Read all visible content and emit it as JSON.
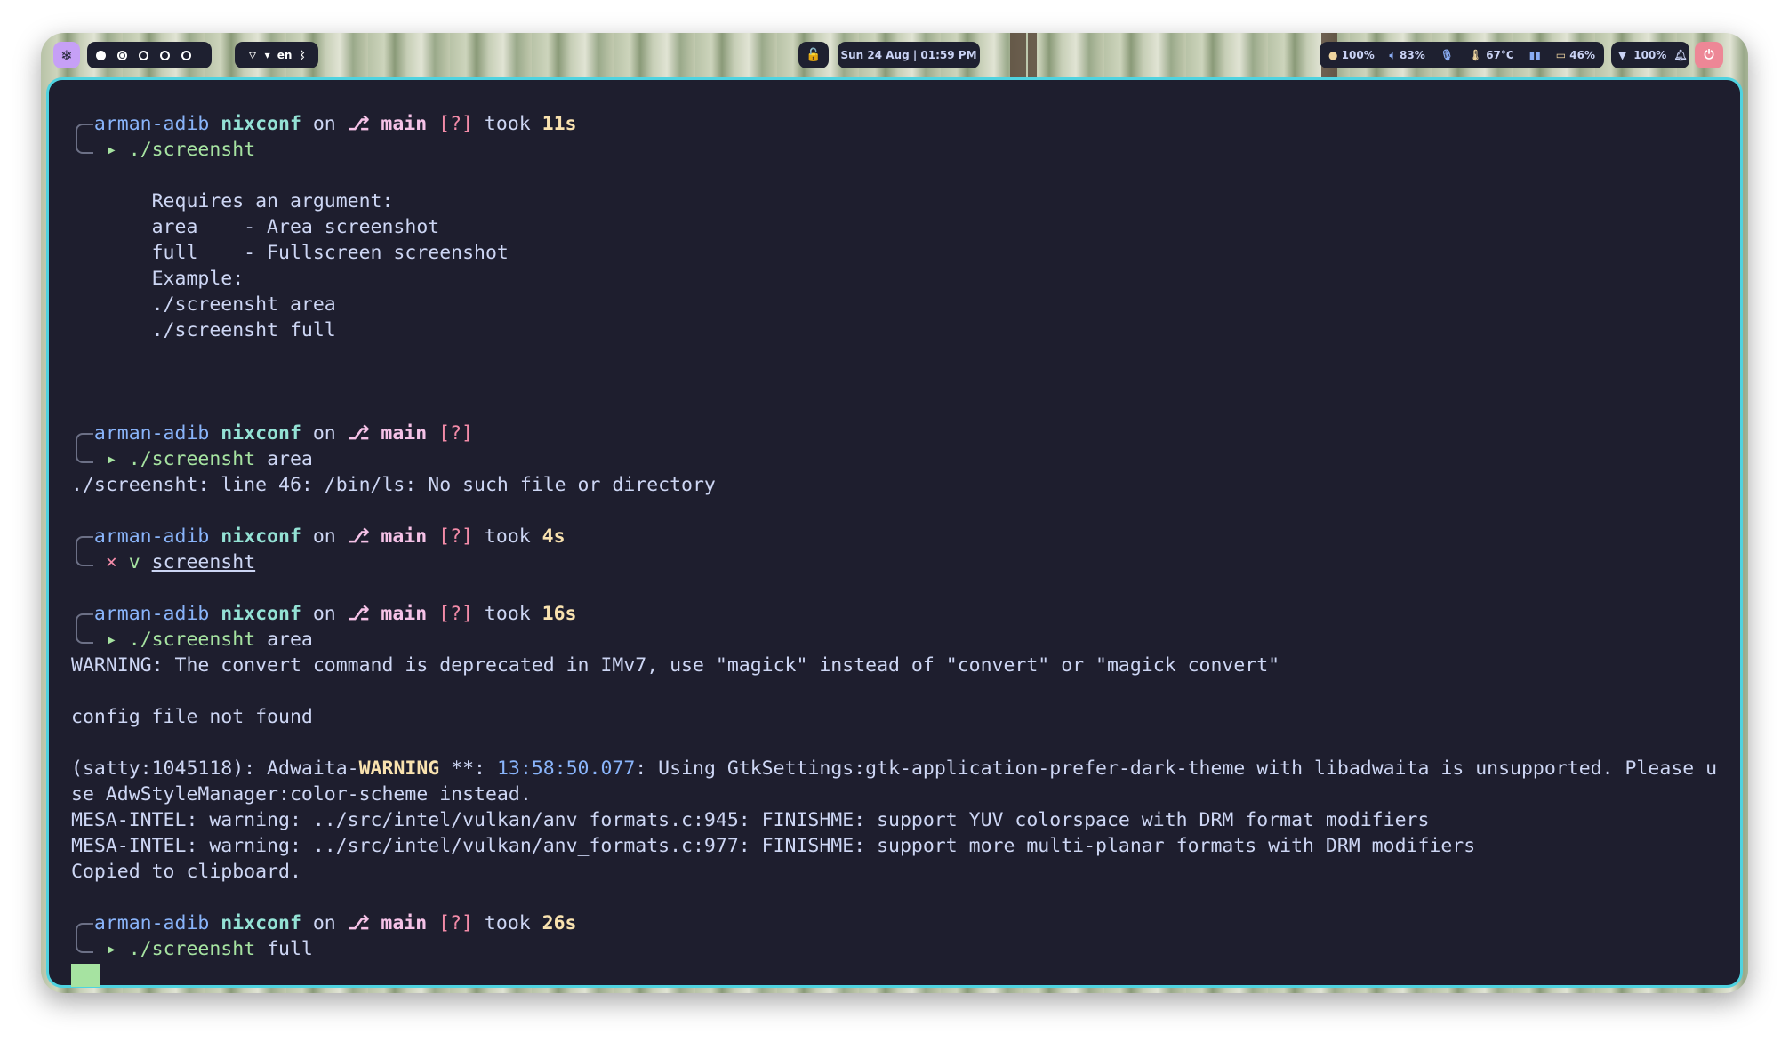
{
  "topbar": {
    "logo": "❄",
    "workspaces": [
      "filled",
      "ring",
      "empty",
      "empty",
      "empty"
    ],
    "network_lang": "en",
    "clock": "Sun 24 Aug | 01:59 PM",
    "brightness": "100%",
    "volume": "83%",
    "temperature": "67°C",
    "battery": "46%",
    "wifi": "100%"
  },
  "terminal": {
    "prompt": {
      "user": "arman-adib",
      "host": "nixconf",
      "on": "on",
      "branch_icon": "⎇",
      "branch": "main",
      "status": "[?]",
      "took": "took"
    },
    "blocks": [
      {
        "took": "11s",
        "ok": true,
        "command": "./screensht",
        "args": "",
        "output": [
          "",
          "       Requires an argument:",
          "       area    - Area screenshot",
          "       full    - Fullscreen screenshot",
          "       Example:",
          "       ./screensht area",
          "       ./screensht full",
          "",
          ""
        ]
      },
      {
        "took": "",
        "ok": true,
        "command": "./screensht",
        "args": " area",
        "output": [
          "./screensht: line 46: /bin/ls: No such file or directory"
        ]
      },
      {
        "took": "4s",
        "ok": false,
        "command": "v ",
        "args_underlined": "screensht",
        "output": []
      },
      {
        "took": "16s",
        "ok": true,
        "command": "./screensht",
        "args": " area",
        "output": [
          "WARNING: The convert command is deprecated in IMv7, use \"magick\" instead of \"convert\" or \"magick convert\"",
          "",
          "config file not found",
          ""
        ],
        "satty": {
          "prefix": "(satty:1045118): Adwaita-",
          "warning": "WARNING",
          "stars": " **: ",
          "time": "13:58:50.077",
          "rest": ": Using GtkSettings:gtk-application-prefer-dark-theme with libadwaita is unsupported. Please u",
          "cont": "se AdwStyleManager:color-scheme instead."
        },
        "tail": [
          "MESA-INTEL: warning: ../src/intel/vulkan/anv_formats.c:945: FINISHME: support YUV colorspace with DRM format modifiers",
          "MESA-INTEL: warning: ../src/intel/vulkan/anv_formats.c:977: FINISHME: support more multi-planar formats with DRM modifiers",
          "Copied to clipboard."
        ]
      },
      {
        "took": "26s",
        "ok": true,
        "command": "./screensht",
        "args": " full",
        "output": []
      }
    ]
  }
}
